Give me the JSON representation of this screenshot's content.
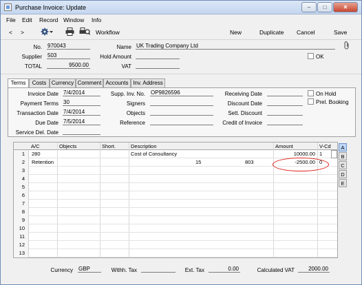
{
  "window": {
    "title": "Purchase Invoice: Update"
  },
  "menu": [
    "File",
    "Edit",
    "Record",
    "Window",
    "Info"
  ],
  "toolbar": {
    "back": "<",
    "forward": ">",
    "workflow_label": "Workflow",
    "new_label": "New",
    "duplicate_label": "Duplicate",
    "cancel_label": "Cancel",
    "save_label": "Save"
  },
  "header": {
    "no_label": "No.",
    "no": "970043",
    "name_label": "Name",
    "name": "UK Trading Company Ltd",
    "supplier_label": "Supplier",
    "supplier": "503",
    "hold_amount_label": "Hold Amount",
    "hold_amount": "",
    "ok_label": "OK",
    "total_label": "TOTAL",
    "total": "9500.00",
    "vat_label": "VAT",
    "vat": ""
  },
  "tabs": [
    "Terms",
    "Costs",
    "Currency",
    "Comment",
    "Accounts",
    "Inv. Address"
  ],
  "terms": {
    "invoice_date_label": "Invoice Date",
    "invoice_date": "7/4/2014",
    "payment_terms_label": "Payment Terms",
    "payment_terms": "30",
    "transaction_date_label": "Transaction Date",
    "transaction_date": "7/4/2014",
    "due_date_label": "Due Date",
    "due_date": "7/5/2014",
    "service_del_date_label": "Service Del. Date",
    "service_del_date": "",
    "supp_inv_no_label": "Supp. Inv. No.",
    "supp_inv_no": "OP9826596",
    "signers_label": "Signers",
    "signers": "",
    "objects_label": "Objects",
    "objects": "",
    "reference_label": "Reference",
    "reference": "",
    "receiving_date_label": "Receiving Date",
    "receiving_date": "",
    "discount_date_label": "Discount Date",
    "discount_date": "",
    "sett_discount_label": "Sett. Discount",
    "sett_discount": "",
    "credit_of_invoice_label": "Credit of Invoice",
    "credit_of_invoice": "",
    "on_hold_label": "On Hold",
    "prel_booking_label": "Prel. Booking"
  },
  "grid": {
    "columns": [
      "A/C",
      "Objects",
      "Short.",
      "Description",
      "Amount",
      "V-Cd"
    ],
    "rows": [
      {
        "n": "1",
        "ac": "280",
        "objects": "",
        "short": "",
        "description": "Cost of Consultancy",
        "amount": "10000.00",
        "vcd": "1"
      },
      {
        "n": "2",
        "ac": "Retention",
        "objects": "",
        "short": "",
        "description": "",
        "extra1": "15",
        "extra2": "803",
        "amount": "-2500.00",
        "vcd": "0"
      },
      {
        "n": "3"
      },
      {
        "n": "4"
      },
      {
        "n": "5"
      },
      {
        "n": "6"
      },
      {
        "n": "7"
      },
      {
        "n": "8"
      },
      {
        "n": "9"
      },
      {
        "n": "10"
      },
      {
        "n": "11"
      },
      {
        "n": "12"
      },
      {
        "n": "13"
      }
    ],
    "side_tabs": [
      "A",
      "B",
      "C",
      "D",
      "E"
    ]
  },
  "footer": {
    "currency_label": "Currency",
    "currency": "GBP",
    "withh_tax_label": "Withh. Tax",
    "withh_tax": "",
    "ext_tax_label": "Ext. Tax",
    "ext_tax": "0.00",
    "calc_vat_label": "Calculated VAT",
    "calc_vat": "2000.00"
  }
}
